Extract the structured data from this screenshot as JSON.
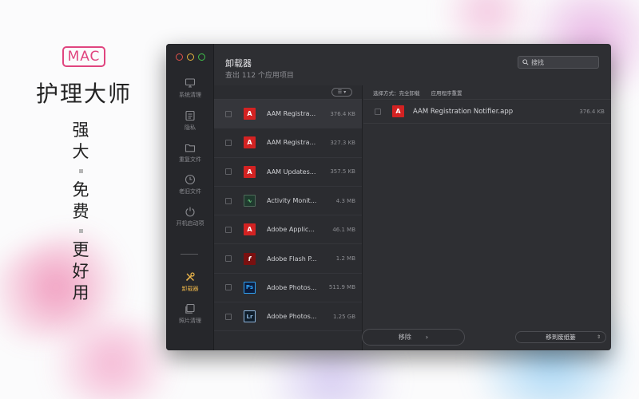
{
  "promo": {
    "badge": "MAC",
    "brand": "护理大师",
    "slogan": [
      "强",
      "大",
      "免",
      "费",
      "更",
      "好",
      "用"
    ]
  },
  "window": {
    "title": "卸载器",
    "subtitle": "查出 112 个应用项目",
    "search_placeholder": "搜找"
  },
  "sidebar": {
    "items": [
      {
        "label": "系统清理",
        "icon": "monitor-icon"
      },
      {
        "label": "隐私",
        "icon": "list-icon"
      },
      {
        "label": "重复文件",
        "icon": "folder-icon"
      },
      {
        "label": "老旧文件",
        "icon": "clock-icon"
      },
      {
        "label": "开机启动项",
        "icon": "power-icon"
      },
      {
        "label": "卸载器",
        "icon": "tools-icon",
        "active": true
      },
      {
        "label": "照片清理",
        "icon": "photos-icon"
      }
    ]
  },
  "apps": [
    {
      "name": "AAM Registra...",
      "size": "376.4 KB",
      "icon": "adobe-icon",
      "selected": true
    },
    {
      "name": "AAM Registra...",
      "size": "327.3 KB",
      "icon": "adobe-icon"
    },
    {
      "name": "AAM Updates...",
      "size": "357.5 KB",
      "icon": "adobe-icon"
    },
    {
      "name": "Activity Monit...",
      "size": "4.3 MB",
      "icon": "activity-monitor-icon"
    },
    {
      "name": "Adobe Applic...",
      "size": "46.1 MB",
      "icon": "adobe-icon"
    },
    {
      "name": "Adobe Flash P...",
      "size": "1.2 MB",
      "icon": "flash-icon"
    },
    {
      "name": "Adobe Photos...",
      "size": "511.9 MB",
      "icon": "photoshop-icon"
    },
    {
      "name": "Adobe Photos...",
      "size": "1.25 GB",
      "icon": "lightroom-icon"
    }
  ],
  "detail": {
    "mode_label": "选择方式：",
    "mode_full": "完全卸载",
    "mode_reset": "应用程序重置",
    "items": [
      {
        "name": "AAM Registration Notifier.app",
        "size": "376.4 KB",
        "icon": "adobe-icon"
      }
    ]
  },
  "actions": {
    "remove_label": "移除",
    "trash_label": "移到废纸篓"
  },
  "colors": {
    "accent": "#e8b34a",
    "brand_pink": "#e0457f",
    "window_bg": "#2e2f33"
  }
}
